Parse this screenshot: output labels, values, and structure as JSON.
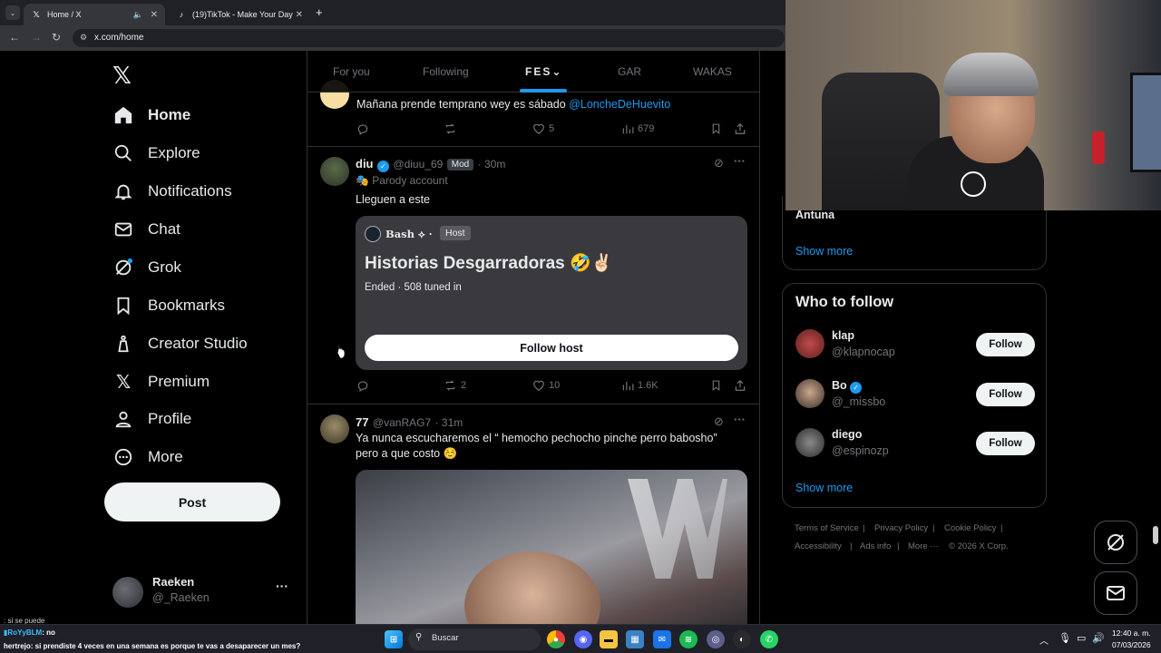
{
  "browser": {
    "tabs": [
      {
        "title": "Home / X"
      },
      {
        "title": "(19)TikTok - Make Your Day"
      }
    ],
    "new_tab": "+",
    "url": "x.com/home"
  },
  "sidebar": {
    "items": [
      {
        "label": "Home"
      },
      {
        "label": "Explore"
      },
      {
        "label": "Notifications"
      },
      {
        "label": "Chat"
      },
      {
        "label": "Grok"
      },
      {
        "label": "Bookmarks"
      },
      {
        "label": "Creator Studio"
      },
      {
        "label": "Premium"
      },
      {
        "label": "Profile"
      },
      {
        "label": "More"
      }
    ],
    "post_label": "Post",
    "account": {
      "name": "Raeken",
      "handle": "@_Raeken",
      "more": "···"
    }
  },
  "timeline": {
    "tabs": [
      {
        "label": "For you"
      },
      {
        "label": "Following"
      },
      {
        "label": "FES"
      },
      {
        "label": "GAR"
      },
      {
        "label": "WAKAS"
      }
    ],
    "tweets": [
      {
        "text_before": "Mañana prende temprano wey es sábado ",
        "mention": "@LoncheDeHuevito",
        "likes": "5",
        "views": "679"
      },
      {
        "name": "diu",
        "handle": "@diuu_69",
        "badge": "Mod",
        "time": "· 30m",
        "parody": "Parody account",
        "text": "Lleguen a este",
        "space": {
          "host_name": "Bash ⟡ ·",
          "host_badge": "Host",
          "title": "Historias Desgarradoras 🤣✌🏻",
          "status": "Ended · 508 tuned in",
          "button": "Follow host"
        },
        "reposts": "2",
        "likes": "10",
        "views": "1.6K"
      },
      {
        "name": "77",
        "handle": "@vanRAG7",
        "time": "· 31m",
        "text_line1": "Ya nunca escucharemos el “ hemocho pechocho pinche perro babosho”",
        "text_line2": "pero a que costo ☺️"
      }
    ]
  },
  "right": {
    "trend_tail": "Antuna",
    "show_more_1": "Show more",
    "wtf_title": "Who to follow",
    "follows": [
      {
        "name": "klap",
        "handle": "@klapnocap",
        "button": "Follow"
      },
      {
        "name": "Bo",
        "handle": "@_missbo",
        "button": "Follow"
      },
      {
        "name": "diego",
        "handle": "@espinozp",
        "button": "Follow"
      }
    ],
    "show_more_2": "Show more",
    "footer": [
      "Terms of Service",
      "|",
      "Privacy Policy",
      "|",
      "Cookie Policy",
      "|",
      "Accessibility",
      "|",
      "Ads info",
      "|",
      "More ···",
      "© 2026 X Corp."
    ]
  },
  "stream_chat": [
    {
      "user": "",
      "text": ": si se puede"
    },
    {
      "user": "RoYyBLM",
      "text": ": no"
    },
    {
      "user": "hertrejo",
      "text": ": si prendiste 4 veces en una semana es porque te vas a desaparecer un mes?"
    }
  ],
  "taskbar": {
    "search": "Buscar",
    "time": "12:40 a. m.",
    "date": "07/03/2026"
  },
  "colors": {
    "accent": "#1d9bf0",
    "background": "#000000"
  }
}
